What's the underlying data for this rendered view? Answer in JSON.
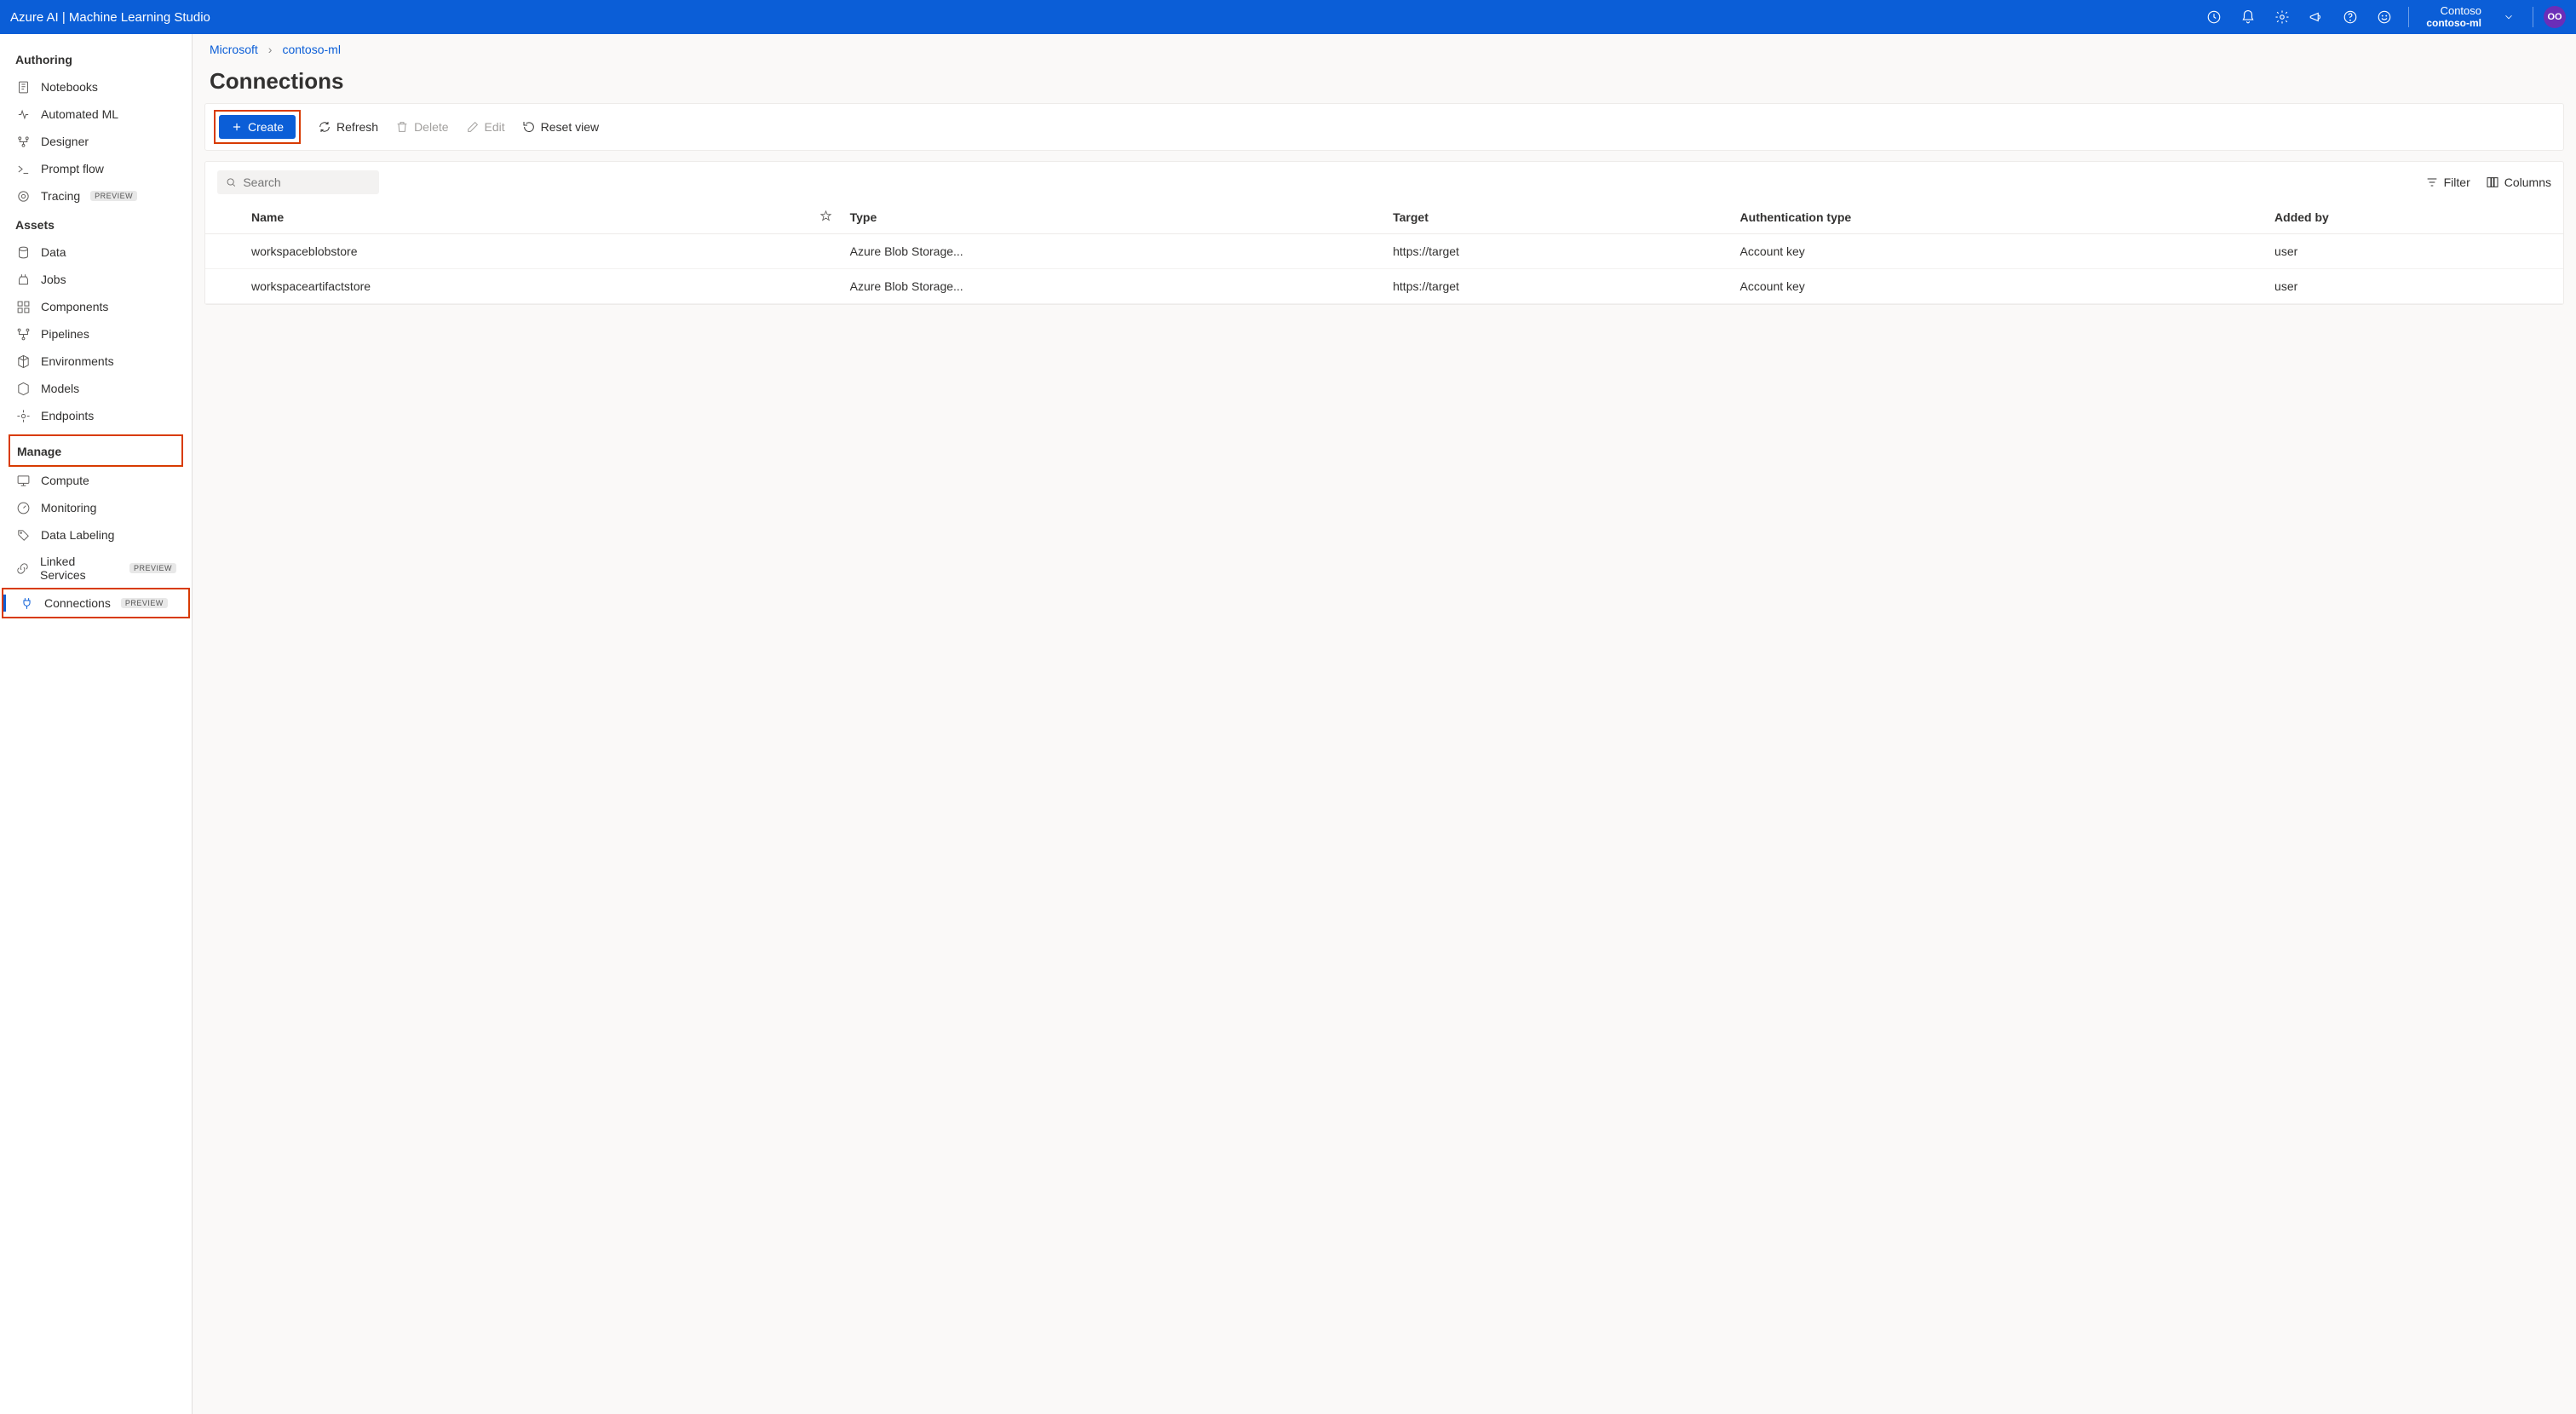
{
  "header": {
    "brand": "Azure AI | Machine Learning Studio",
    "tenant": "Contoso",
    "workspace": "contoso-ml",
    "avatar_initials": "OO"
  },
  "sidebar": {
    "sections": {
      "authoring": {
        "label": "Authoring"
      },
      "assets": {
        "label": "Assets"
      },
      "manage": {
        "label": "Manage"
      }
    },
    "items": {
      "notebooks": {
        "label": "Notebooks"
      },
      "automl": {
        "label": "Automated ML"
      },
      "designer": {
        "label": "Designer"
      },
      "promptflow": {
        "label": "Prompt flow"
      },
      "tracing": {
        "label": "Tracing",
        "badge": "PREVIEW"
      },
      "data": {
        "label": "Data"
      },
      "jobs": {
        "label": "Jobs"
      },
      "components": {
        "label": "Components"
      },
      "pipelines": {
        "label": "Pipelines"
      },
      "environments": {
        "label": "Environments"
      },
      "models": {
        "label": "Models"
      },
      "endpoints": {
        "label": "Endpoints"
      },
      "compute": {
        "label": "Compute"
      },
      "monitoring": {
        "label": "Monitoring"
      },
      "datalabeling": {
        "label": "Data Labeling"
      },
      "linkedservices": {
        "label": "Linked Services",
        "badge": "PREVIEW"
      },
      "connections": {
        "label": "Connections",
        "badge": "PREVIEW"
      }
    }
  },
  "breadcrumb": {
    "root": "Microsoft",
    "leaf": "contoso-ml"
  },
  "page": {
    "title": "Connections"
  },
  "toolbar": {
    "create": "Create",
    "refresh": "Refresh",
    "delete": "Delete",
    "edit": "Edit",
    "resetview": "Reset view"
  },
  "panel": {
    "search_placeholder": "Search",
    "filter": "Filter",
    "columns_btn": "Columns",
    "columns": {
      "name": "Name",
      "type": "Type",
      "target": "Target",
      "auth": "Authentication type",
      "addedby": "Added by"
    },
    "rows": [
      {
        "name": "workspaceblobstore",
        "type": "Azure Blob Storage...",
        "target": "https://target",
        "auth": "Account key",
        "addedby": "user"
      },
      {
        "name": "workspaceartifactstore",
        "type": "Azure Blob Storage...",
        "target": "https://target",
        "auth": "Account key",
        "addedby": "user"
      }
    ]
  }
}
